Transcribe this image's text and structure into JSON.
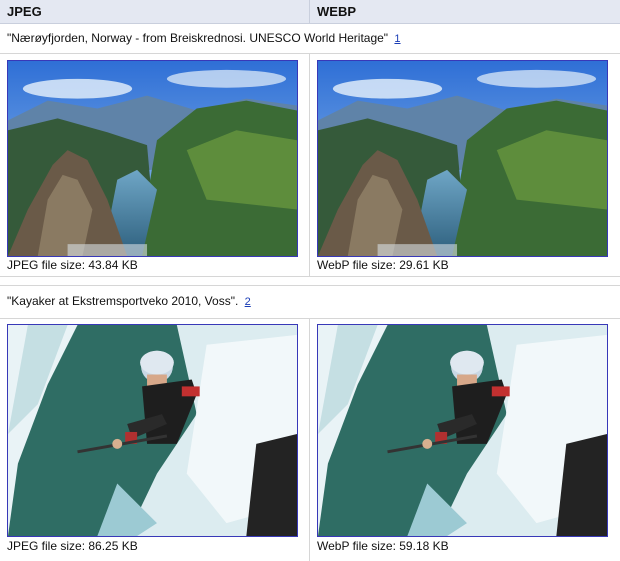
{
  "table": {
    "headers": {
      "left": "JPEG",
      "right": "WEBP"
    },
    "rows": [
      {
        "caption": "\"Nærøyfjorden, Norway - from Breiskrednosi. UNESCO World Heritage\"",
        "ref_link": "1",
        "jpeg_label": "JPEG file size: 43.84 KB",
        "webp_label": "WebP file size: 29.61 KB",
        "image_subject": "fjord-landscape"
      },
      {
        "caption": "\"Kayaker at Ekstremsportveko 2010, Voss\".",
        "ref_link": "2",
        "jpeg_label": "JPEG file size: 86.25 KB",
        "webp_label": "WebP file size: 59.18 KB",
        "image_subject": "kayaker-waterfall"
      }
    ]
  },
  "colors": {
    "header_bg": "#e4e8f2",
    "link": "#1a3db6",
    "image_border": "#3838b8"
  }
}
